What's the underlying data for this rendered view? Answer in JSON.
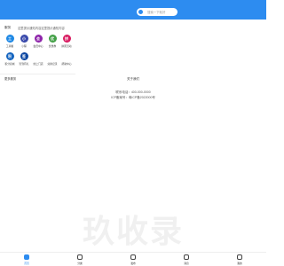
{
  "search": {
    "placeholder": "搜索一下就好"
  },
  "panel": {
    "title": "服务",
    "notice": "这里提示通知内容这里提示通知内容",
    "apps": [
      {
        "label": "工具箱",
        "icon": "circle-blue",
        "glyph": "工",
        "color": "#1e88e5"
      },
      {
        "label": "小程",
        "icon": "circle-indigo",
        "glyph": "小",
        "color": "#3949ab"
      },
      {
        "label": "会员中心",
        "icon": "circle-purple",
        "glyph": "会",
        "color": "#8e24aa"
      },
      {
        "label": "优惠券",
        "icon": "circle-green",
        "glyph": "优",
        "color": "#43a047"
      },
      {
        "label": "拼团活动",
        "icon": "circle-pink",
        "glyph": "拼",
        "color": "#d81b60"
      },
      {
        "label": "积分商城",
        "icon": "circle-blue-2",
        "glyph": "积",
        "color": "#1565c0"
      },
      {
        "label": "签到有礼",
        "icon": "circle-blue-3",
        "glyph": "签",
        "color": "#0d47a1"
      },
      {
        "label": "线上门店",
        "icon": "blank",
        "glyph": "",
        "color": "#ffffff"
      },
      {
        "label": "兑换记录",
        "icon": "blank",
        "glyph": "",
        "color": "#ffffff"
      },
      {
        "label": "帮助中心",
        "icon": "blank",
        "glyph": "",
        "color": "#ffffff"
      }
    ],
    "footer": "更多服务"
  },
  "about": "关于我们",
  "contact": {
    "phone": "联系电话：400-000-0000",
    "icp": "ICP备案号：粤ICP备2022000号"
  },
  "watermark": "玖收录",
  "bottom_nav": [
    {
      "label": "首页",
      "icon": "home-icon",
      "active": true
    },
    {
      "label": "分类",
      "icon": "category-icon",
      "active": false
    },
    {
      "label": "发布",
      "icon": "publish-icon",
      "active": false
    },
    {
      "label": "消息",
      "icon": "message-icon",
      "active": false
    },
    {
      "label": "我的",
      "icon": "profile-icon",
      "active": false
    }
  ]
}
